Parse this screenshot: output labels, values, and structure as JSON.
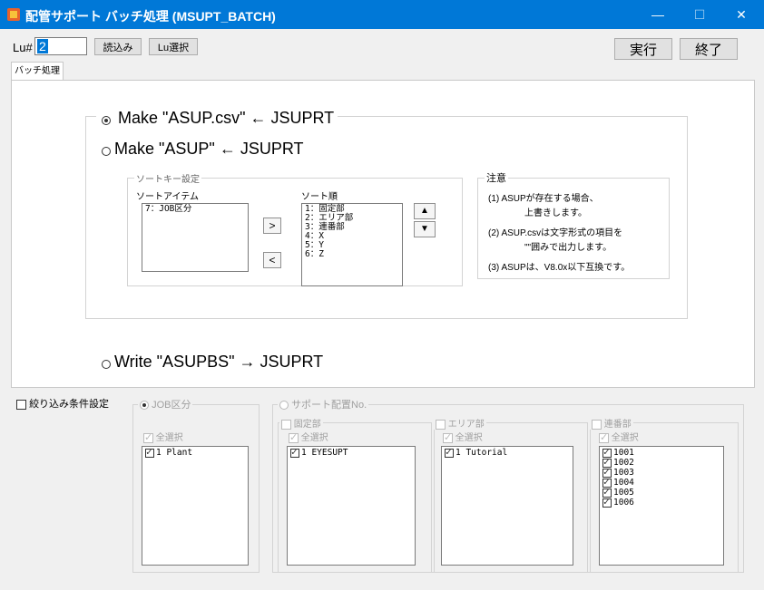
{
  "window": {
    "title": "配管サポート バッチ処理 (MSUPT_BATCH)",
    "minimize": "—",
    "maximize": "☐",
    "close": "✕"
  },
  "toolbar": {
    "lu_label": "Lu#",
    "lu_value": "2",
    "load_label": "読込み",
    "lu_select_label": "Lu選択",
    "run_label": "実行",
    "exit_label": "終了"
  },
  "tabs": [
    {
      "label": "バッチ処理"
    }
  ],
  "options": {
    "make_csv": "Make \"ASUP.csv\"  ←  JSUPRT",
    "make_asup": "Make \"ASUP\"  ←  JSUPRT",
    "write_asupbs": "Write \"ASUPBS\"  →  JSUPRT"
  },
  "sort": {
    "group_title": "ソートキー設定",
    "items_label": "ソートアイテム",
    "order_label": "ソート順",
    "items": [
      "7：JOB区分"
    ],
    "order": [
      "1：固定部",
      "2：エリア部",
      "3：連番部",
      "4：X",
      "5：Y",
      "6：Z"
    ],
    "move_right": ">",
    "move_left": "<",
    "up": "▲",
    "down": "▼"
  },
  "notes": {
    "title": "注意",
    "lines": [
      "(1)  ASUPが存在する場合、",
      "上書きします。",
      "(2)  ASUP.csvは文字形式の項目を",
      "\"\"囲みで出力します。",
      "(3)  ASUPは、V8.0x以下互換です。"
    ]
  },
  "filter": {
    "enable_label": "絞り込み条件設定",
    "job_label": "JOB区分",
    "support_label": "サポート配置No.",
    "select_all": "全選択",
    "job_items": [
      "1   Plant"
    ],
    "fixed_label": "固定部",
    "fixed_items": [
      "1   EYESUPT"
    ],
    "area_label": "エリア部",
    "area_items": [
      "1   Tutorial"
    ],
    "serial_label": "連番部",
    "serial_items": [
      "1001",
      "1002",
      "1003",
      "1004",
      "1005",
      "1006"
    ]
  },
  "colors": {
    "titlebar": "#0078d7",
    "window_bg": "#f0f0f0",
    "panel_bg": "#ffffff",
    "lu_highlight": "#0078d7"
  }
}
